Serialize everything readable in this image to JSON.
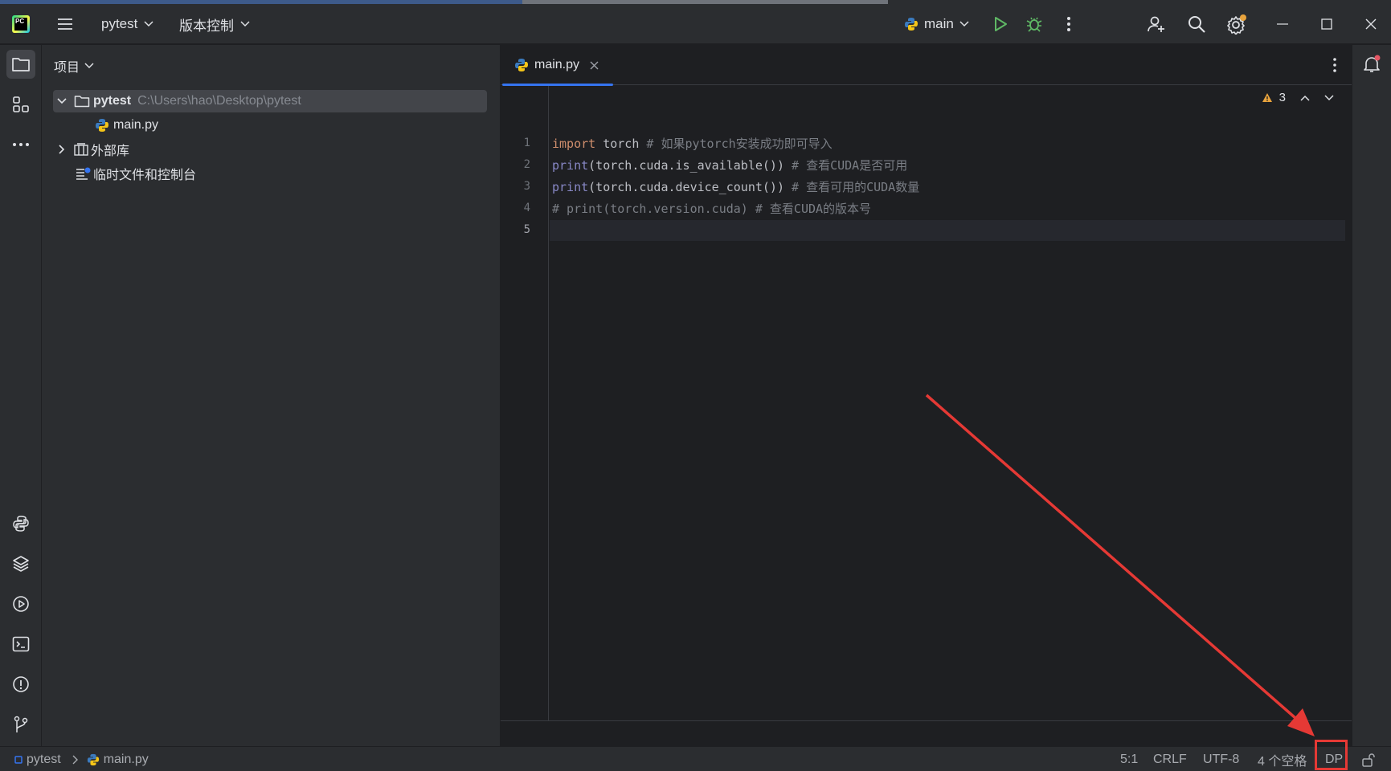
{
  "titlebar": {
    "logo_text": "PC",
    "project_name": "pytest",
    "vcs_label": "版本控制",
    "run_config": "main"
  },
  "sidebar": {
    "header": "项目",
    "tree": [
      {
        "label": "pytest",
        "path": "C:\\Users\\hao\\Desktop\\pytest"
      },
      {
        "label": "main.py"
      },
      {
        "label": "外部库"
      },
      {
        "label": "临时文件和控制台"
      }
    ]
  },
  "editor": {
    "tab_label": "main.py",
    "inspections_count": "3",
    "line_numbers": [
      "1",
      "2",
      "3",
      "4",
      "5"
    ],
    "lines": [
      {
        "kw": "import",
        "code": " torch",
        "comment": " # 如果pytorch安装成功即可导入"
      },
      {
        "fn": "print",
        "code": "(torch.cuda.is_available())",
        "comment": " # 查看CUDA是否可用"
      },
      {
        "fn": "print",
        "code": "(torch.cuda.device_count())",
        "comment": " # 查看可用的CUDA数量"
      },
      {
        "comment": "# print(torch.version.cuda) # 查看CUDA的版本号"
      }
    ]
  },
  "statusbar": {
    "breadcrumb_project": "pytest",
    "breadcrumb_file": "main.py",
    "position": "5:1",
    "line_sep": "CRLF",
    "encoding": "UTF-8",
    "indent": "4 个空格",
    "interpreter": "DP"
  },
  "colors": {
    "accent": "#3574f0",
    "annotation": "#e53935",
    "background": "#1e1f22",
    "panel": "#2b2d30"
  }
}
